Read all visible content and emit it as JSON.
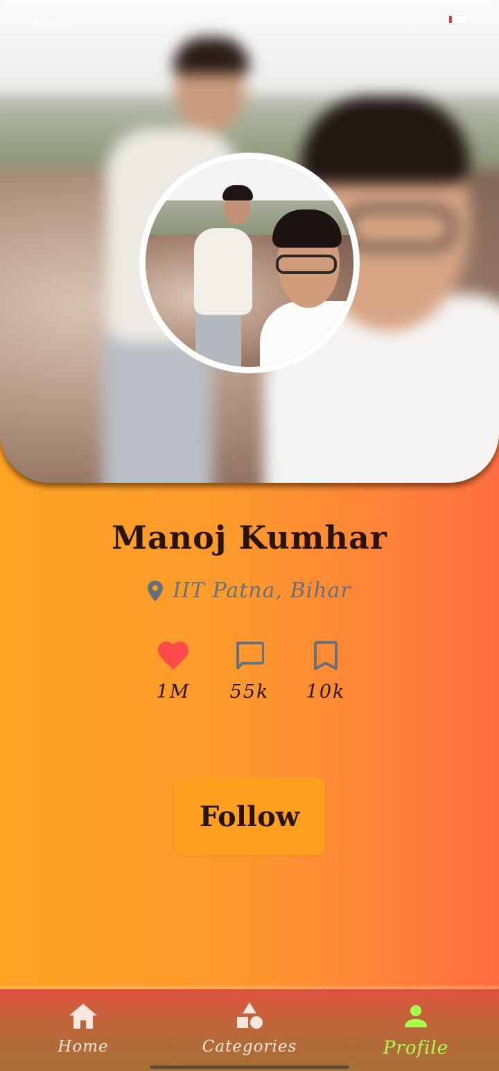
{
  "status_bar": {
    "time": "11:11",
    "icons": "ill ⚬ ⊕ ≈",
    "battery_level_percent": 15
  },
  "profile": {
    "name": "Manoj Kumhar",
    "location": "IIT Patna, Bihar",
    "stats": [
      {
        "icon": "heart-icon",
        "value": "1M",
        "color": "#fc4a4a"
      },
      {
        "icon": "comment-icon",
        "value": "55k",
        "color": "#66707a"
      },
      {
        "icon": "bookmark-icon",
        "value": "10k",
        "color": "#66707a"
      }
    ],
    "follow_label": "Follow"
  },
  "bottom_nav": {
    "items": [
      {
        "label": "Home",
        "icon": "home-icon"
      },
      {
        "label": "Categories",
        "icon": "categories-icon"
      },
      {
        "label": "Profile",
        "icon": "person-icon",
        "active": true
      }
    ],
    "active_color": "#a6ff4d"
  },
  "theme": {
    "gradient_start": "#fda323",
    "gradient_end": "#ff6e40",
    "button_color": "#fda01f",
    "text_color": "#2a1408"
  }
}
